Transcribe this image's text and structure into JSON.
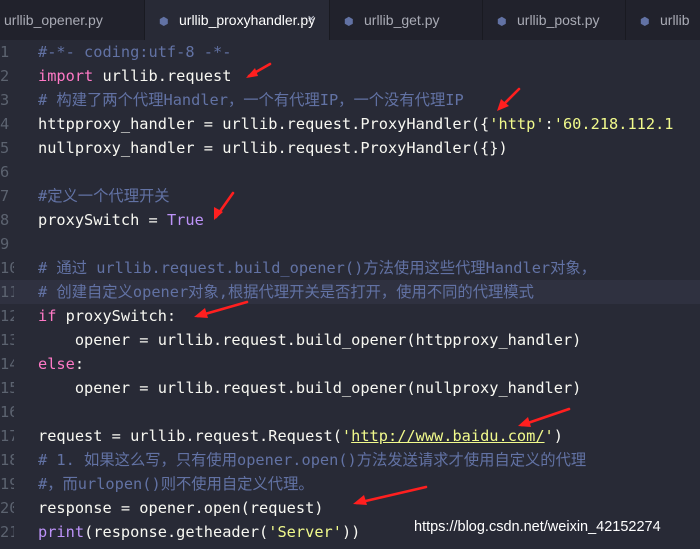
{
  "tabs": [
    {
      "label": "urllib_opener.py",
      "active": false
    },
    {
      "label": "urllib_proxyhandler.py",
      "active": true
    },
    {
      "label": "urllib_get.py",
      "active": false
    },
    {
      "label": "urllib_post.py",
      "active": false
    },
    {
      "label": "urllib",
      "active": false
    }
  ],
  "tab_close_glyph": "×",
  "file_icon": "python-file-icon",
  "editor": {
    "lines": [
      {
        "n": "1",
        "parts": [
          {
            "t": "#-*- coding:utf-8 -*-",
            "c": "cm"
          }
        ]
      },
      {
        "n": "2",
        "parts": [
          {
            "t": "import",
            "c": "kw"
          },
          {
            "t": " urllib.request",
            "c": "fn"
          }
        ]
      },
      {
        "n": "3",
        "parts": [
          {
            "t": "# 构建了两个代理Handler，一个有代理IP，一个没有代理IP",
            "c": "cm"
          }
        ]
      },
      {
        "n": "4",
        "parts": [
          {
            "t": "httpproxy_handler = urllib.request.ProxyHandler({",
            "c": "fn"
          },
          {
            "t": "'http'",
            "c": "str"
          },
          {
            "t": ":",
            "c": "fn"
          },
          {
            "t": "'60.218.112.1",
            "c": "str"
          }
        ]
      },
      {
        "n": "5",
        "parts": [
          {
            "t": "nullproxy_handler = urllib.request.ProxyHandler({})",
            "c": "fn"
          }
        ]
      },
      {
        "n": "6",
        "parts": []
      },
      {
        "n": "7",
        "parts": [
          {
            "t": "#定义一个代理开关",
            "c": "cm"
          }
        ]
      },
      {
        "n": "8",
        "parts": [
          {
            "t": "proxySwitch = ",
            "c": "fn"
          },
          {
            "t": "True",
            "c": "cst"
          }
        ]
      },
      {
        "n": "9",
        "parts": []
      },
      {
        "n": "10",
        "parts": [
          {
            "t": "# 通过 urllib.request.build_opener()方法使用这些代理Handler对象，",
            "c": "cm"
          }
        ]
      },
      {
        "n": "11",
        "parts": [
          {
            "t": "# 创建自定义opener对象,根据代理开关是否打开，使用不同的代理模式",
            "c": "cm"
          }
        ],
        "current": true
      },
      {
        "n": "12",
        "parts": [
          {
            "t": "if",
            "c": "kw"
          },
          {
            "t": " proxySwitch:",
            "c": "fn"
          }
        ]
      },
      {
        "n": "13",
        "parts": [
          {
            "t": "    opener = urllib.request.build_opener(httpproxy_handler)",
            "c": "fn"
          }
        ]
      },
      {
        "n": "14",
        "parts": [
          {
            "t": "else",
            "c": "kw"
          },
          {
            "t": ":",
            "c": "fn"
          }
        ]
      },
      {
        "n": "15",
        "parts": [
          {
            "t": "    opener = urllib.request.build_opener(nullproxy_handler)",
            "c": "fn"
          }
        ]
      },
      {
        "n": "16",
        "parts": []
      },
      {
        "n": "17",
        "parts": [
          {
            "t": "request = urllib.request.Request(",
            "c": "fn"
          },
          {
            "t": "'",
            "c": "str"
          },
          {
            "t": "http://www.baidu.com/",
            "c": "str url"
          },
          {
            "t": "'",
            "c": "str"
          },
          {
            "t": ")",
            "c": "fn"
          }
        ]
      },
      {
        "n": "18",
        "parts": [
          {
            "t": "# 1. 如果这么写，只有使用opener.open()方法发送请求才使用自定义的代理",
            "c": "cm"
          }
        ]
      },
      {
        "n": "19",
        "parts": [
          {
            "t": "#，而urlopen()则不使用自定义代理。",
            "c": "cm"
          }
        ]
      },
      {
        "n": "20",
        "parts": [
          {
            "t": "response = opener.open(request)",
            "c": "fn"
          }
        ]
      },
      {
        "n": "21",
        "parts": [
          {
            "t": "print",
            "c": "cst"
          },
          {
            "t": "(response.getheader(",
            "c": "fn"
          },
          {
            "t": "'Server'",
            "c": "str"
          },
          {
            "t": "))",
            "c": "fn"
          }
        ]
      }
    ]
  },
  "watermark": "https://blog.csdn.net/weixin_42152274",
  "colors": {
    "background": "#282a36",
    "tabbar": "#21222c",
    "keyword": "#ff79c6",
    "string": "#f1fa8c",
    "constant": "#bd93f9",
    "comment": "#6272a4",
    "arrow": "#ff1f1f"
  }
}
